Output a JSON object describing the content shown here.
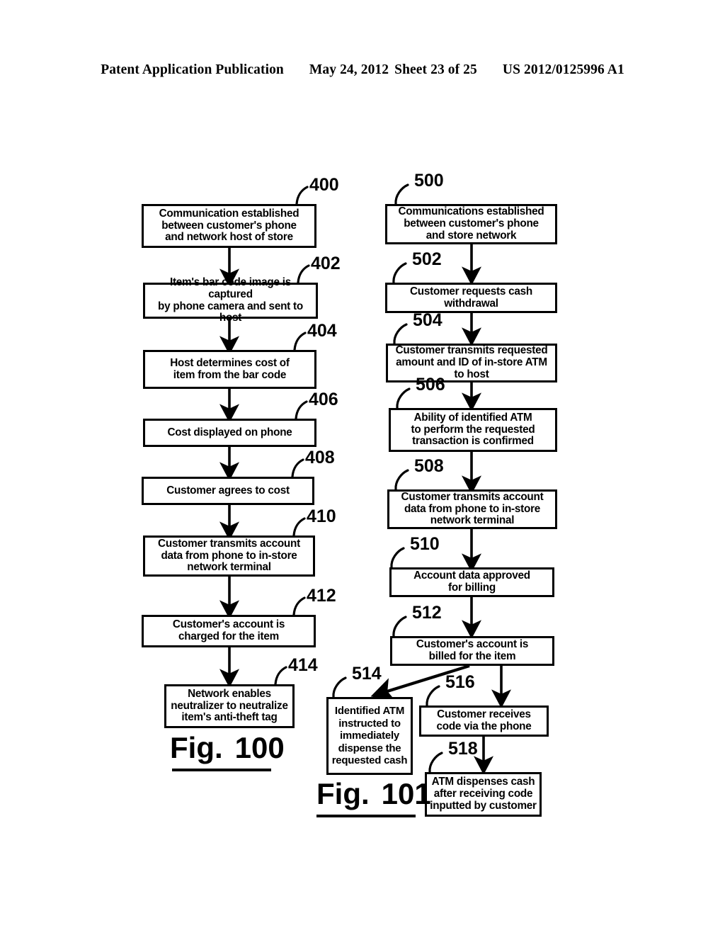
{
  "header": {
    "publication": "Patent Application Publication",
    "date": "May 24, 2012",
    "sheet": "Sheet 23 of 25",
    "docnum": "US 2012/0125996 A1"
  },
  "figures": [
    {
      "caption_prefix": "Fig.",
      "caption_number": "100",
      "nodes": [
        {
          "ref": "400",
          "text": "Communication established between customer's phone and network host of store"
        },
        {
          "ref": "402",
          "text": "Item's bar code image is captured by phone camera and sent to host"
        },
        {
          "ref": "404",
          "text": "Host determines cost of item from the bar code"
        },
        {
          "ref": "406",
          "text": "Cost displayed on phone"
        },
        {
          "ref": "408",
          "text": "Customer agrees to cost"
        },
        {
          "ref": "410",
          "text": "Customer transmits account data from phone to in-store network terminal"
        },
        {
          "ref": "412",
          "text": "Customer's account is charged for the item"
        },
        {
          "ref": "414",
          "text": "Network enables neutralizer to neutralize item's anti-theft tag"
        }
      ]
    },
    {
      "caption_prefix": "Fig.",
      "caption_number": "101",
      "nodes": [
        {
          "ref": "500",
          "text": "Communications established between customer's phone and store network"
        },
        {
          "ref": "502",
          "text": "Customer requests cash withdrawal"
        },
        {
          "ref": "504",
          "text": "Customer transmits requested amount and ID of in-store ATM to host"
        },
        {
          "ref": "506",
          "text": "Ability of identified ATM to perform the requested transaction is confirmed"
        },
        {
          "ref": "508",
          "text": "Customer transmits account data from phone to in-store network terminal"
        },
        {
          "ref": "510",
          "text": "Account data approved for billing"
        },
        {
          "ref": "512",
          "text": "Customer's account is billed for the item"
        },
        {
          "ref": "514",
          "text": "Identified ATM instructed to immediately dispense the requested cash"
        },
        {
          "ref": "516",
          "text": "Customer receives code via the phone"
        },
        {
          "ref": "518",
          "text": "ATM dispenses cash after receiving code inputted by customer"
        }
      ]
    }
  ],
  "lines": {
    "n400": [
      "Communication established",
      "between customer's phone",
      "and network host of store"
    ],
    "n402": [
      "Item's bar code image is captured",
      "by phone camera and sent to host"
    ],
    "n404": [
      "Host determines cost of",
      "item from the bar code"
    ],
    "n406": [
      "Cost displayed on phone"
    ],
    "n408": [
      "Customer agrees to cost"
    ],
    "n410": [
      "Customer transmits account",
      "data from phone to in-store",
      "network terminal"
    ],
    "n412": [
      "Customer's account is",
      "charged for the item"
    ],
    "n414": [
      "Network enables",
      "neutralizer to neutralize",
      "item's anti-theft tag"
    ],
    "n500": [
      "Communications established",
      "between customer's phone",
      "and store network"
    ],
    "n502": [
      "Customer requests cash",
      "withdrawal"
    ],
    "n504": [
      "Customer transmits requested",
      "amount and ID of in-store ATM",
      "to host"
    ],
    "n506": [
      "Ability of identified ATM",
      "to perform the requested",
      "transaction is confirmed"
    ],
    "n508": [
      "Customer transmits account",
      "data from phone to in-store",
      "network terminal"
    ],
    "n510": [
      "Account data approved",
      "for billing"
    ],
    "n512": [
      "Customer's account is",
      "billed for the item"
    ],
    "n514": [
      "Identified ATM",
      "instructed to",
      "immediately",
      "dispense the",
      "requested cash"
    ],
    "n516": [
      "Customer receives",
      "code via the phone"
    ],
    "n518": [
      "ATM dispenses cash",
      "after receiving code",
      "inputted by customer"
    ]
  },
  "refs": {
    "r400": "400",
    "r402": "402",
    "r404": "404",
    "r406": "406",
    "r408": "408",
    "r410": "410",
    "r412": "412",
    "r414": "414",
    "r500": "500",
    "r502": "502",
    "r504": "504",
    "r506": "506",
    "r508": "508",
    "r510": "510",
    "r512": "512",
    "r514": "514",
    "r516": "516",
    "r518": "518"
  },
  "captions": {
    "fig100_prefix": "Fig.",
    "fig100_number": "100",
    "fig101_prefix": "Fig.",
    "fig101_number": "101"
  },
  "colors": {
    "ink": "#000000",
    "paper": "#ffffff"
  }
}
